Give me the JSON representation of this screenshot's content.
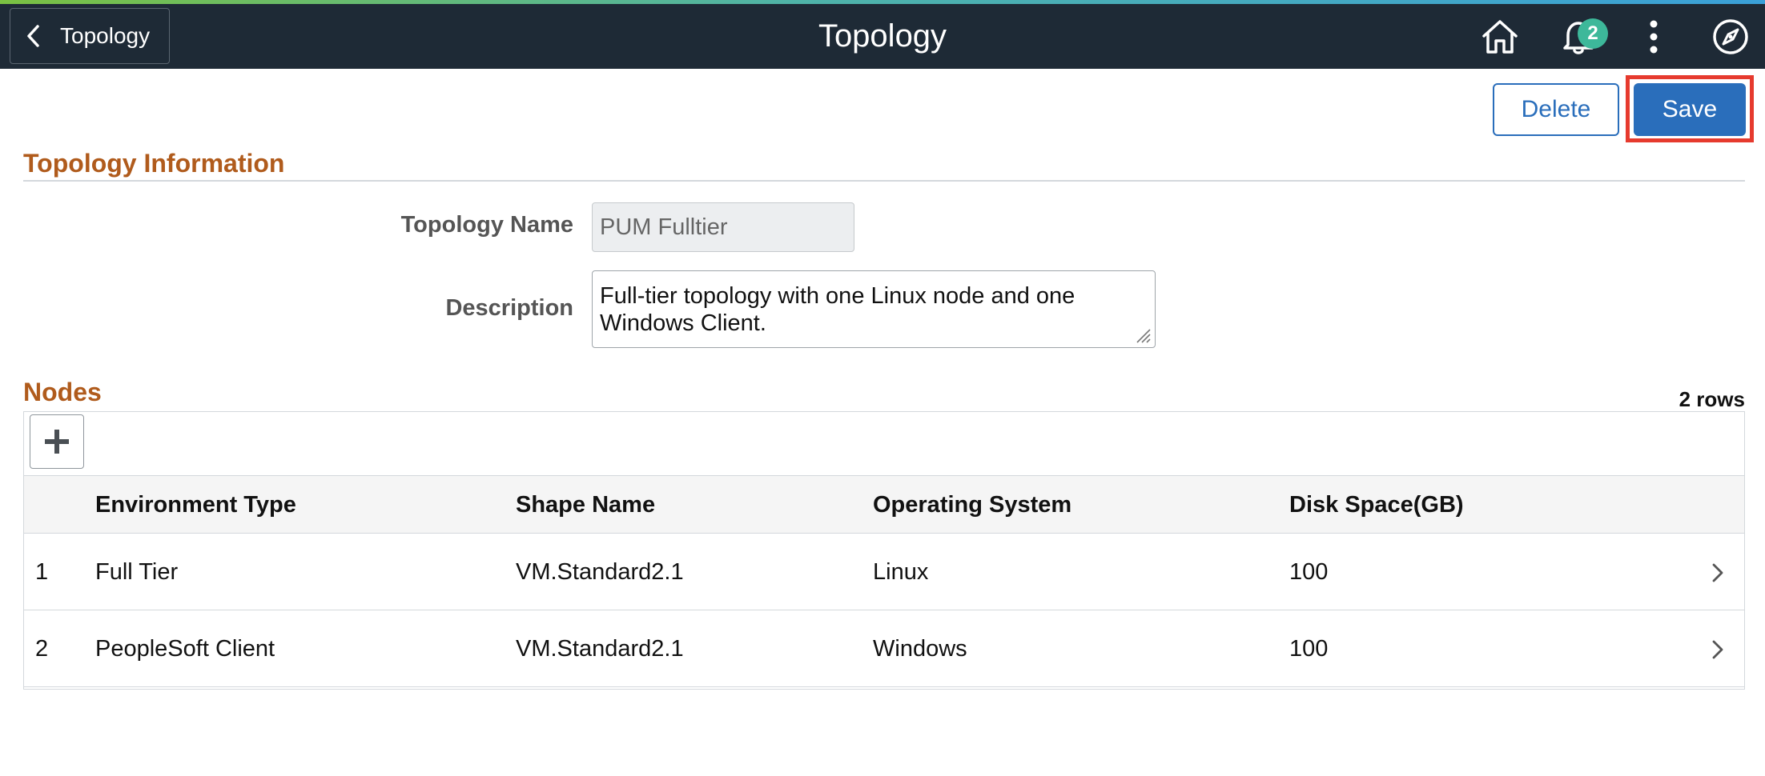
{
  "header": {
    "back_label": "Topology",
    "title": "Topology",
    "notification_count": "2",
    "icons": [
      "home-icon",
      "bell-icon",
      "more-vertical-icon",
      "compass-icon"
    ]
  },
  "actions": {
    "delete_label": "Delete",
    "save_label": "Save"
  },
  "topology_info": {
    "section_title": "Topology Information",
    "name_label": "Topology Name",
    "name_value": "PUM Fulltier",
    "description_label": "Description",
    "description_value": "Full-tier topology with one Linux node and one Windows Client."
  },
  "nodes": {
    "section_title": "Nodes",
    "row_count": "2 rows",
    "columns": [
      "Environment Type",
      "Shape Name",
      "Operating System",
      "Disk Space(GB)"
    ],
    "rows": [
      {
        "num": "1",
        "env_type": "Full Tier",
        "shape": "VM.Standard2.1",
        "os": "Linux",
        "disk": "100"
      },
      {
        "num": "2",
        "env_type": "PeopleSoft Client",
        "shape": "VM.Standard2.1",
        "os": "Windows",
        "disk": "100"
      }
    ]
  },
  "colors": {
    "header_bg": "#1e2a36",
    "accent": "#2a6ebb",
    "section_title": "#b05b1c",
    "badge": "#3db89a",
    "highlight": "#e63a2e"
  }
}
